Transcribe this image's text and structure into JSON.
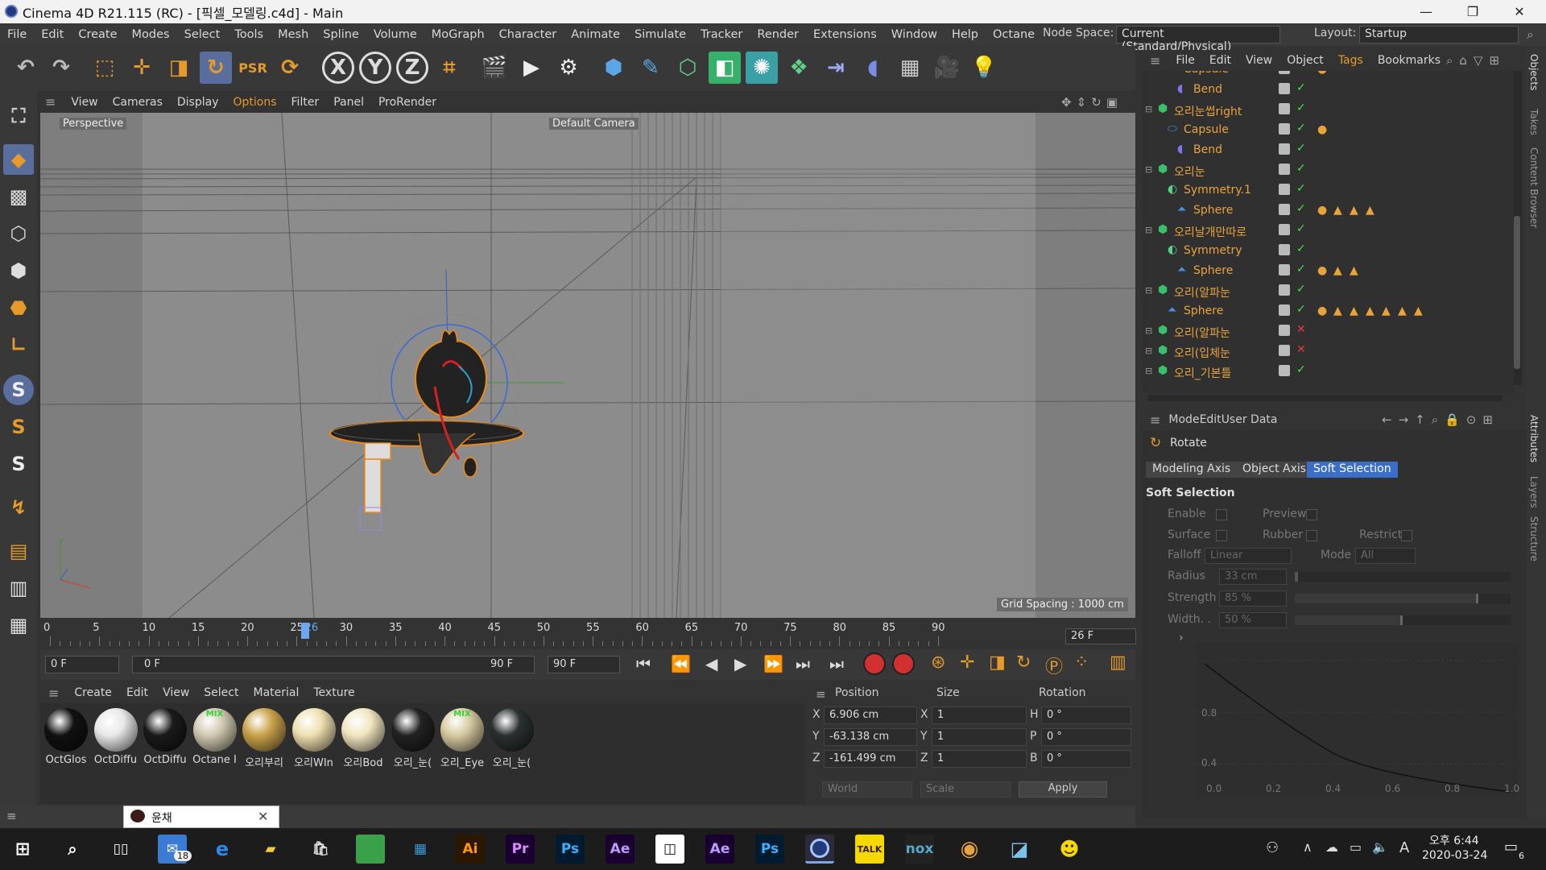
{
  "window": {
    "title": "Cinema 4D R21.115 (RC) - [픽셀_모델링.c4d] - Main",
    "minimize": "—",
    "maximize": "❐",
    "close": "✕"
  },
  "menu": [
    "File",
    "Edit",
    "Create",
    "Modes",
    "Select",
    "Tools",
    "Mesh",
    "Spline",
    "Volume",
    "MoGraph",
    "Character",
    "Animate",
    "Simulate",
    "Tracker",
    "Render",
    "Extensions",
    "Window",
    "Help",
    "Octane"
  ],
  "nodespace": {
    "label": "Node Space:",
    "value": "Current (Standard/Physical)"
  },
  "layout": {
    "label": "Layout:",
    "value": "Startup"
  },
  "toolbar": {
    "x": "X",
    "y": "Y",
    "z": "Z"
  },
  "left_tools": {
    "s1": "S",
    "s2": "S",
    "s3": "S"
  },
  "viewport_menu": [
    "View",
    "Cameras",
    "Display",
    "Options",
    "Filter",
    "Panel",
    "ProRender"
  ],
  "viewport": {
    "label": "Perspective",
    "camera": "Default Camera",
    "grid": "Grid Spacing : 1000 cm",
    "axis_y": "y"
  },
  "timeline": {
    "ticks": [
      "0",
      "5",
      "10",
      "15",
      "20",
      "25",
      "26",
      "30",
      "35",
      "40",
      "45",
      "50",
      "55",
      "60",
      "65",
      "70",
      "75",
      "80",
      "85",
      "90"
    ],
    "current": "26 F",
    "start": "0 F",
    "range_start": "0 F",
    "range_end": "90 F",
    "end": "90 F"
  },
  "materials_menu": [
    "Create",
    "Edit",
    "View",
    "Select",
    "Material",
    "Texture"
  ],
  "materials": [
    {
      "name": "OctGlos",
      "color": "#111111"
    },
    {
      "name": "OctDiffu",
      "color": "#e8e8e8"
    },
    {
      "name": "OctDiffu",
      "color": "#1a1a1a"
    },
    {
      "name": "Octane I",
      "color": "#d0c8b0"
    },
    {
      "name": "오리부리",
      "color": "#c9a24a"
    },
    {
      "name": "오리WIn",
      "color": "#efe0b0"
    },
    {
      "name": "오리Bod",
      "color": "#f1e6c0"
    },
    {
      "name": "오리_눈(",
      "color": "#222222"
    },
    {
      "name": "오리_Eye",
      "color": "#d6caa0"
    },
    {
      "name": "오리_눈(",
      "color": "#2a3030"
    }
  ],
  "mix_tag": "MIX",
  "coords": {
    "headers": [
      "Position",
      "Size",
      "Rotation"
    ],
    "rows": [
      {
        "axis": "X",
        "pos": "6.906 cm",
        "saxis": "X",
        "size": "1",
        "raxis": "H",
        "rot": "0 °"
      },
      {
        "axis": "Y",
        "pos": "-63.138 cm",
        "saxis": "Y",
        "size": "1",
        "raxis": "P",
        "rot": "0 °"
      },
      {
        "axis": "Z",
        "pos": "-161.499 cm",
        "saxis": "Z",
        "size": "1",
        "raxis": "B",
        "rot": "0 °"
      }
    ],
    "world": "World",
    "scale": "Scale",
    "apply": "Apply"
  },
  "object_menu": [
    "File",
    "Edit",
    "View",
    "Object",
    "Tags",
    "Bookmarks"
  ],
  "objects": [
    {
      "name": "Capsule",
      "indent": 2,
      "kind": "capsule"
    },
    {
      "name": "Bend",
      "indent": 3,
      "kind": "bend"
    },
    {
      "name": "오리눈썹right",
      "indent": 1,
      "kind": "null"
    },
    {
      "name": "Capsule",
      "indent": 2,
      "kind": "capsule"
    },
    {
      "name": "Bend",
      "indent": 3,
      "kind": "bend"
    },
    {
      "name": "오리눈",
      "indent": 1,
      "kind": "null"
    },
    {
      "name": "Symmetry.1",
      "indent": 2,
      "kind": "sym"
    },
    {
      "name": "Sphere",
      "indent": 3,
      "kind": "sphere"
    },
    {
      "name": "오리날개만따로",
      "indent": 1,
      "kind": "null"
    },
    {
      "name": "Symmetry",
      "indent": 2,
      "kind": "sym"
    },
    {
      "name": "Sphere",
      "indent": 3,
      "kind": "sphere"
    },
    {
      "name": "오리(알파눈",
      "indent": 1,
      "kind": "null"
    },
    {
      "name": "Sphere",
      "indent": 2,
      "kind": "sphere"
    },
    {
      "name": "오리(알파눈",
      "indent": 1,
      "kind": "null"
    },
    {
      "name": "오리(입체눈",
      "indent": 1,
      "kind": "null"
    },
    {
      "name": "오리_기본틀",
      "indent": 1,
      "kind": "null"
    }
  ],
  "attr_menu": [
    "Mode",
    "Edit",
    "User Data"
  ],
  "attr": {
    "tool": "Rotate",
    "tabs": [
      "Modeling Axis",
      "Object Axis",
      "Soft Selection"
    ],
    "section": "Soft Selection",
    "enable": "Enable",
    "preview": "Preview",
    "surface": "Surface",
    "rubber": "Rubber",
    "restrict": "Restrict",
    "falloff": "Falloff",
    "falloff_val": "Linear",
    "mode": "Mode",
    "mode_val": "All",
    "radius": "Radius",
    "radius_val": "33 cm",
    "strength": "Strength",
    "strength_val": "85 %",
    "width": "Width. .",
    "width_val": "50 %",
    "graph_y": [
      "0.8",
      "0.4"
    ],
    "graph_x": [
      "0.0",
      "0.2",
      "0.4",
      "0.6",
      "0.8",
      "1.0"
    ],
    "strength_fill": 0.85,
    "width_fill": 0.5
  },
  "right_tabs": [
    "Objects",
    "Takes",
    "Content Browser",
    "Attributes",
    "Layers",
    "Structure"
  ],
  "status": {
    "chat": "윤채"
  },
  "taskbar": {
    "mail_badge": "18",
    "time": "오후 6:44",
    "date": "2020-03-24",
    "ime": "A",
    "notif": "6"
  },
  "colors": {
    "accent": "#ffaa00",
    "obj_orange": "#e8a33c",
    "active_tab": "#3b6ec7"
  }
}
